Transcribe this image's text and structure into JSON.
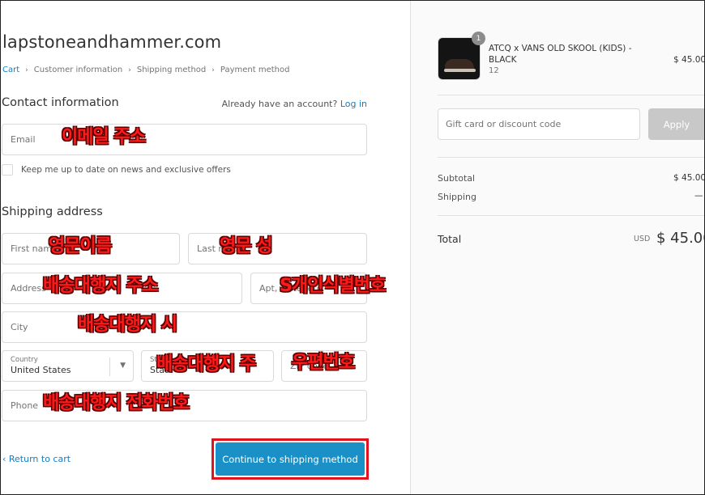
{
  "store": {
    "name": "lapstoneandhammer.com"
  },
  "breadcrumb": {
    "items": [
      "Cart",
      "Customer information",
      "Shipping method",
      "Payment method"
    ],
    "separator": "›"
  },
  "contact": {
    "title": "Contact information",
    "login_prompt": "Already have an account?",
    "login_link": "Log in",
    "email_placeholder": "Email",
    "newsletter_label": "Keep me up to date on news and exclusive offers"
  },
  "shipping": {
    "title": "Shipping address",
    "first_name_placeholder": "First name",
    "last_name_placeholder": "Last name",
    "address_placeholder": "Address",
    "apt_placeholder": "Apt, suite, etc.",
    "city_placeholder": "City",
    "country_label": "Country",
    "country_value": "United States",
    "state_label": "State",
    "state_value": "State",
    "zip_placeholder": "ZIP code",
    "phone_placeholder": "Phone"
  },
  "annotations": {
    "email": "이메일 주소",
    "first_name": "영문이름",
    "last_name": "영문 성",
    "address": "배송대행지 주소",
    "apt": "S개인식별번호",
    "city": "배송대행지 시",
    "state": "배송대행지 주",
    "zip": "우편번호",
    "phone": "배송대행지 전화번호",
    "highlight_color": "#e0141e"
  },
  "actions": {
    "return_label": "‹ Return to cart",
    "continue_label": "Continue to shipping method"
  },
  "order": {
    "item": {
      "quantity": "1",
      "name": "ATCQ x VANS OLD SKOOL (KIDS) - BLACK",
      "variant": "12",
      "price": "$ 45.00"
    },
    "discount_placeholder": "Gift card or discount code",
    "apply_label": "Apply",
    "subtotal_label": "Subtotal",
    "subtotal_value": "$ 45.00",
    "shipping_label": "Shipping",
    "shipping_value": "—",
    "total_label": "Total",
    "currency": "USD",
    "total_value": "$ 45.00"
  },
  "colors": {
    "link": "#197bbd",
    "primary_button": "#1990c6",
    "annotation_text": "#ff1a1a"
  }
}
